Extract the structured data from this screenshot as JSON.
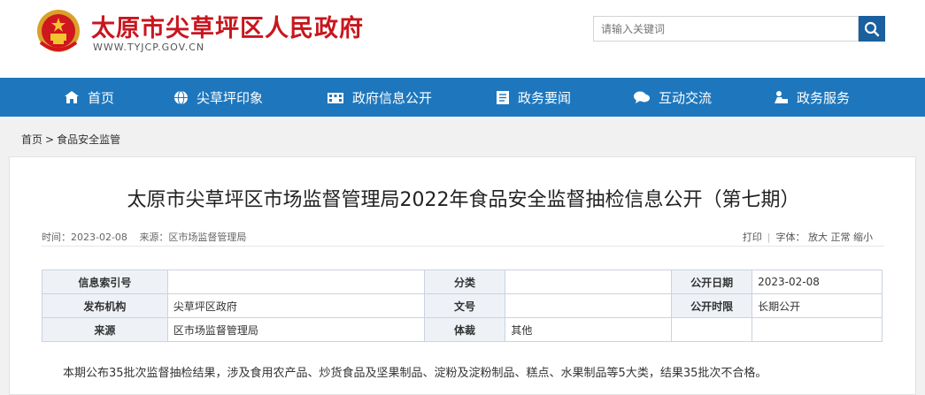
{
  "header": {
    "site_title": "太原市尖草坪区人民政府",
    "site_domain": "WWW.TYJCP.GOV.CN",
    "search_placeholder": "请输入关键词"
  },
  "nav": {
    "items": [
      {
        "label": "首页",
        "icon": "home-icon"
      },
      {
        "label": "尖草坪印象",
        "icon": "globe-icon"
      },
      {
        "label": "政府信息公开",
        "icon": "building-icon"
      },
      {
        "label": "政务要闻",
        "icon": "news-icon"
      },
      {
        "label": "互动交流",
        "icon": "chat-icon"
      },
      {
        "label": "政务服务",
        "icon": "service-icon"
      }
    ]
  },
  "breadcrumb": {
    "home": "首页",
    "separator": ">",
    "current": "食品安全监管"
  },
  "article": {
    "title": "太原市尖草坪区市场监督管理局2022年食品安全监督抽检信息公开（第七期）",
    "time_label": "时间：2023-02-08",
    "source_label": "来源：区市场监督管理局",
    "print": "打印",
    "font_label": "字体：",
    "font_large": "放大",
    "font_normal": "正常",
    "font_small": "缩小",
    "summary": "本期公布35批次监督抽检结果，涉及食用农产品、炒货食品及坚果制品、淀粉及淀粉制品、糕点、水果制品等5大类，结果35批次不合格。"
  },
  "info_table": {
    "index_label": "信息索引号",
    "index_value": "",
    "category_label": "分类",
    "category_value": "",
    "date_label": "公开日期",
    "date_value": "2023-02-08",
    "publisher_label": "发布机构",
    "publisher_value": "尖草坪区政府",
    "doc_no_label": "文号",
    "doc_no_value": "",
    "period_label": "公开时限",
    "period_value": "长期公开",
    "source_label": "来源",
    "source_value": "区市场监督管理局",
    "genre_label": "体裁",
    "genre_value": "其他"
  },
  "colors": {
    "brand_red": "#c8161e",
    "nav_blue": "#1e77bd",
    "search_button": "#1a5f9e"
  }
}
